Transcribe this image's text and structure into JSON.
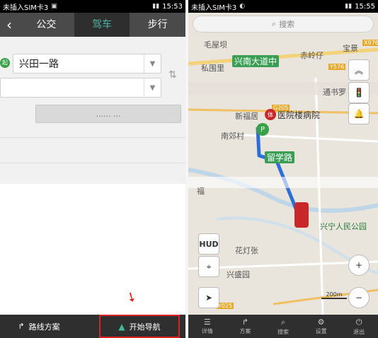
{
  "left": {
    "status": {
      "carrier": "未插入SIM卡3",
      "time": "15:53"
    },
    "tabs": [
      {
        "label": "公交",
        "active": false
      },
      {
        "label": "驾车",
        "active": true
      },
      {
        "label": "步行",
        "active": false
      }
    ],
    "start": {
      "value": "兴田一路",
      "marker": "起"
    },
    "end": {
      "value": ""
    },
    "plan_button": "...... ...",
    "bottom": {
      "route_plan": "路线方案",
      "start_nav": "开始导航"
    }
  },
  "right": {
    "status": {
      "carrier": "未插入SIM卡3",
      "time": "15:55"
    },
    "search_placeholder": "搜索",
    "map": {
      "road_labels": [
        "兴南大道中",
        "留学路"
      ],
      "place_labels": [
        "毛屋坝",
        "私围里",
        "赤岭仔",
        "宝景",
        "通书罗",
        "新福居",
        "南郊村",
        "福",
        "花灯张",
        "兴盛园",
        "兴宁人民公园"
      ],
      "hospital": "医院楼病院",
      "hospital_badge": "体",
      "highway_tags": [
        "X976",
        "Y576",
        "G205",
        "Y025"
      ],
      "scale": "200m"
    },
    "controls": {
      "hud": "HUD"
    },
    "bottom": [
      {
        "icon": "list-icon",
        "label": "详情"
      },
      {
        "icon": "route-icon",
        "label": "方案"
      },
      {
        "icon": "search-icon",
        "label": "搜索"
      },
      {
        "icon": "gear-icon",
        "label": "设置"
      },
      {
        "icon": "power-icon",
        "label": "退出"
      }
    ]
  },
  "colors": {
    "accent": "#4fb3a8",
    "highlight": "#e02020",
    "road_green": "#3a9f55",
    "route_blue": "#2d6fd6"
  }
}
